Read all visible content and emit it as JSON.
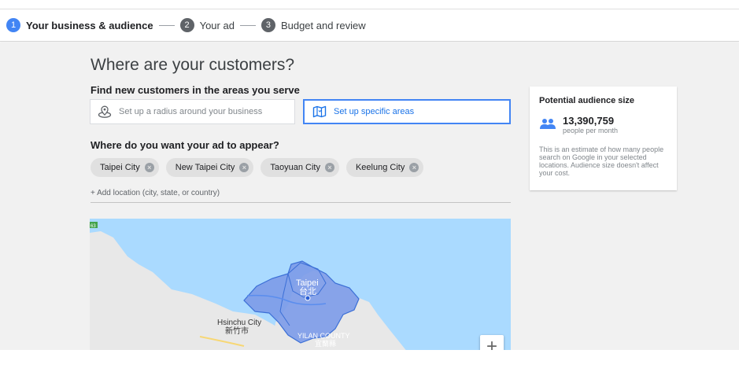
{
  "stepper": {
    "steps": [
      {
        "num": "1",
        "label": "Your business & audience",
        "active": true
      },
      {
        "num": "2",
        "label": "Your ad",
        "active": false
      },
      {
        "num": "3",
        "label": "Budget and review",
        "active": false
      }
    ]
  },
  "main": {
    "title": "Where are your customers?",
    "serve_label": "Find new customers in the areas you serve",
    "options": {
      "radius_label": "Set up a radius around your business",
      "areas_label": "Set up specific areas",
      "selected": "areas"
    },
    "appear_label": "Where do you want your ad to appear?",
    "locations": [
      "Taipei City",
      "New Taipei City",
      "Taoyuan City",
      "Keelung City"
    ],
    "add_location": "+ Add location (city, state, or country)"
  },
  "map": {
    "route_badge": "63",
    "labels": {
      "taipei_en": "Taipei",
      "taipei_zh": "台北",
      "hsinchu_en": "Hsinchu City",
      "hsinchu_zh": "新竹市",
      "yilan_en": "YILAN COUNTY",
      "yilan_zh": "宜蘭縣"
    },
    "zoom_in": "+",
    "colors": {
      "sea": "#aadaff",
      "land": "#e8e8e8",
      "region": "#7e9ce8",
      "region_stroke": "#3b6fd6"
    }
  },
  "audience": {
    "title": "Potential audience size",
    "count": "13,390,759",
    "per": "people per month",
    "description": "This is an estimate of how many people search on Google in your selected locations. Audience size doesn't affect your cost."
  },
  "colors": {
    "accent": "#4285f4",
    "link": "#1a73e8"
  }
}
